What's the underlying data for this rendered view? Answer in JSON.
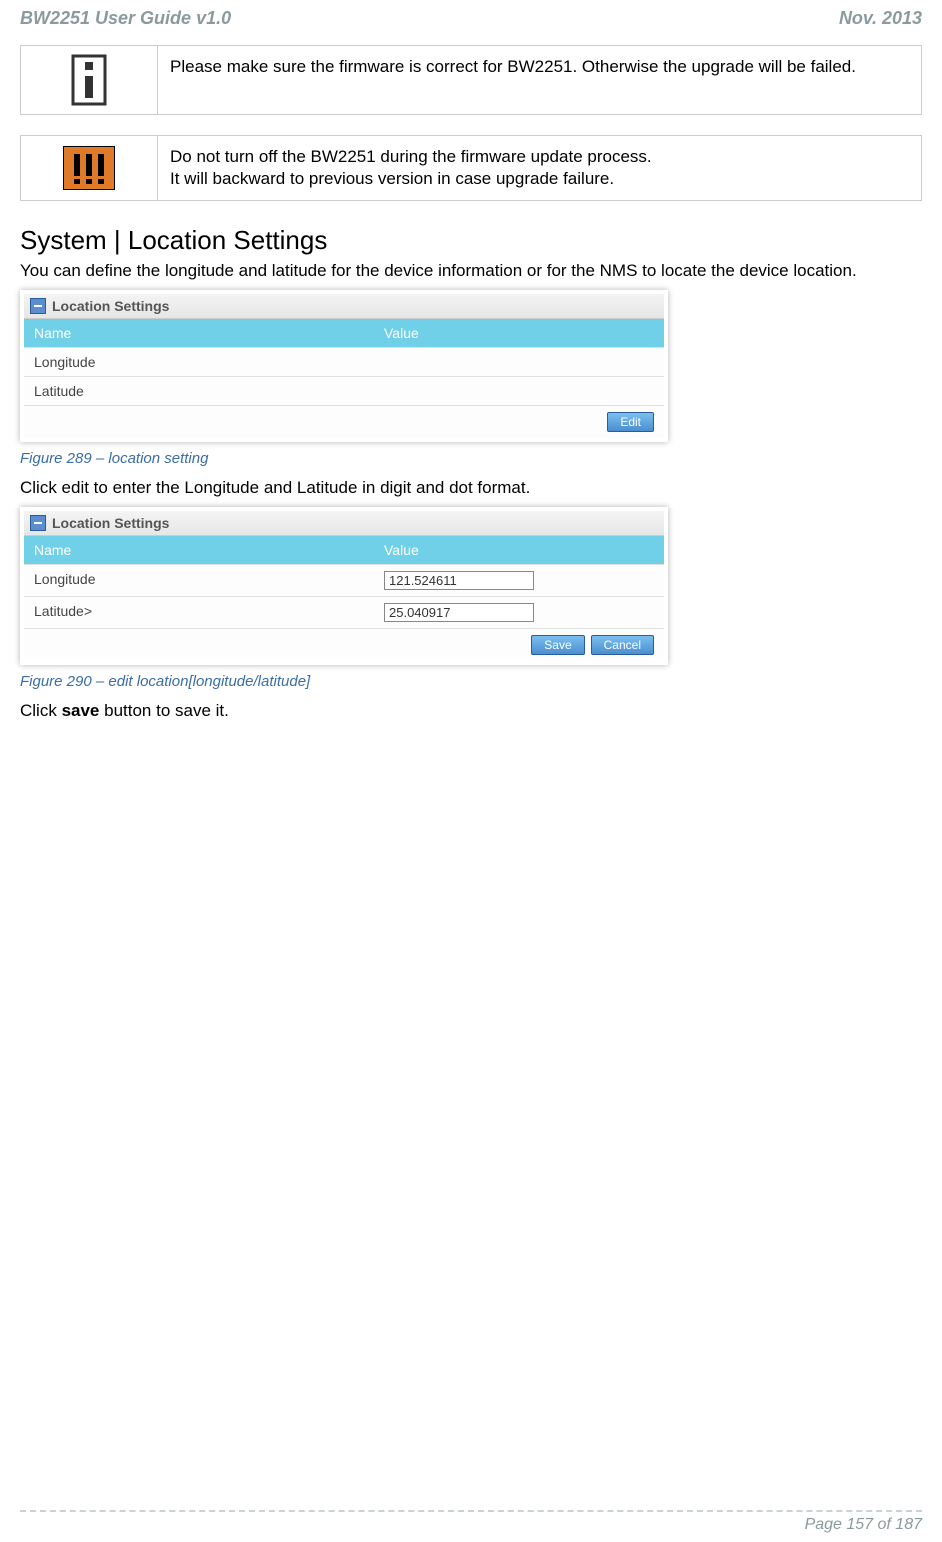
{
  "header": {
    "left": "BW2251 User Guide v1.0",
    "right": "Nov.  2013"
  },
  "callout_info": {
    "text": "Please make sure the firmware is correct for BW2251. Otherwise the upgrade will be failed."
  },
  "callout_warn": {
    "line1": "Do not turn off the BW2251 during the firmware update process.",
    "line2": "It will backward to previous version in case upgrade failure."
  },
  "section_title": "System | Location Settings",
  "intro_text": "You can define the longitude and latitude for the device information or for the NMS to locate the device location.",
  "panel1": {
    "title": "Location Settings",
    "head_left": "Name",
    "head_right": "Value",
    "rows": [
      {
        "name": "Longitude",
        "value": ""
      },
      {
        "name": "Latitude",
        "value": ""
      }
    ],
    "btn_edit": "Edit"
  },
  "caption1": "Figure 289 – location setting",
  "mid_text": "Click edit to enter the Longitude and Latitude in digit and dot format.",
  "panel2": {
    "title": "Location Settings",
    "head_left": "Name",
    "head_right": "Value",
    "rows": [
      {
        "name": "Longitude",
        "value": "121.524611"
      },
      {
        "name": "Latitude>",
        "value": "25.040917"
      }
    ],
    "btn_save": "Save",
    "btn_cancel": "Cancel"
  },
  "caption2": "Figure 290 – edit location[longitude/latitude]",
  "save_text_pre": "Click ",
  "save_text_bold": "save",
  "save_text_post": " button to save it.",
  "footer": {
    "page": "Page 157 of 187"
  }
}
